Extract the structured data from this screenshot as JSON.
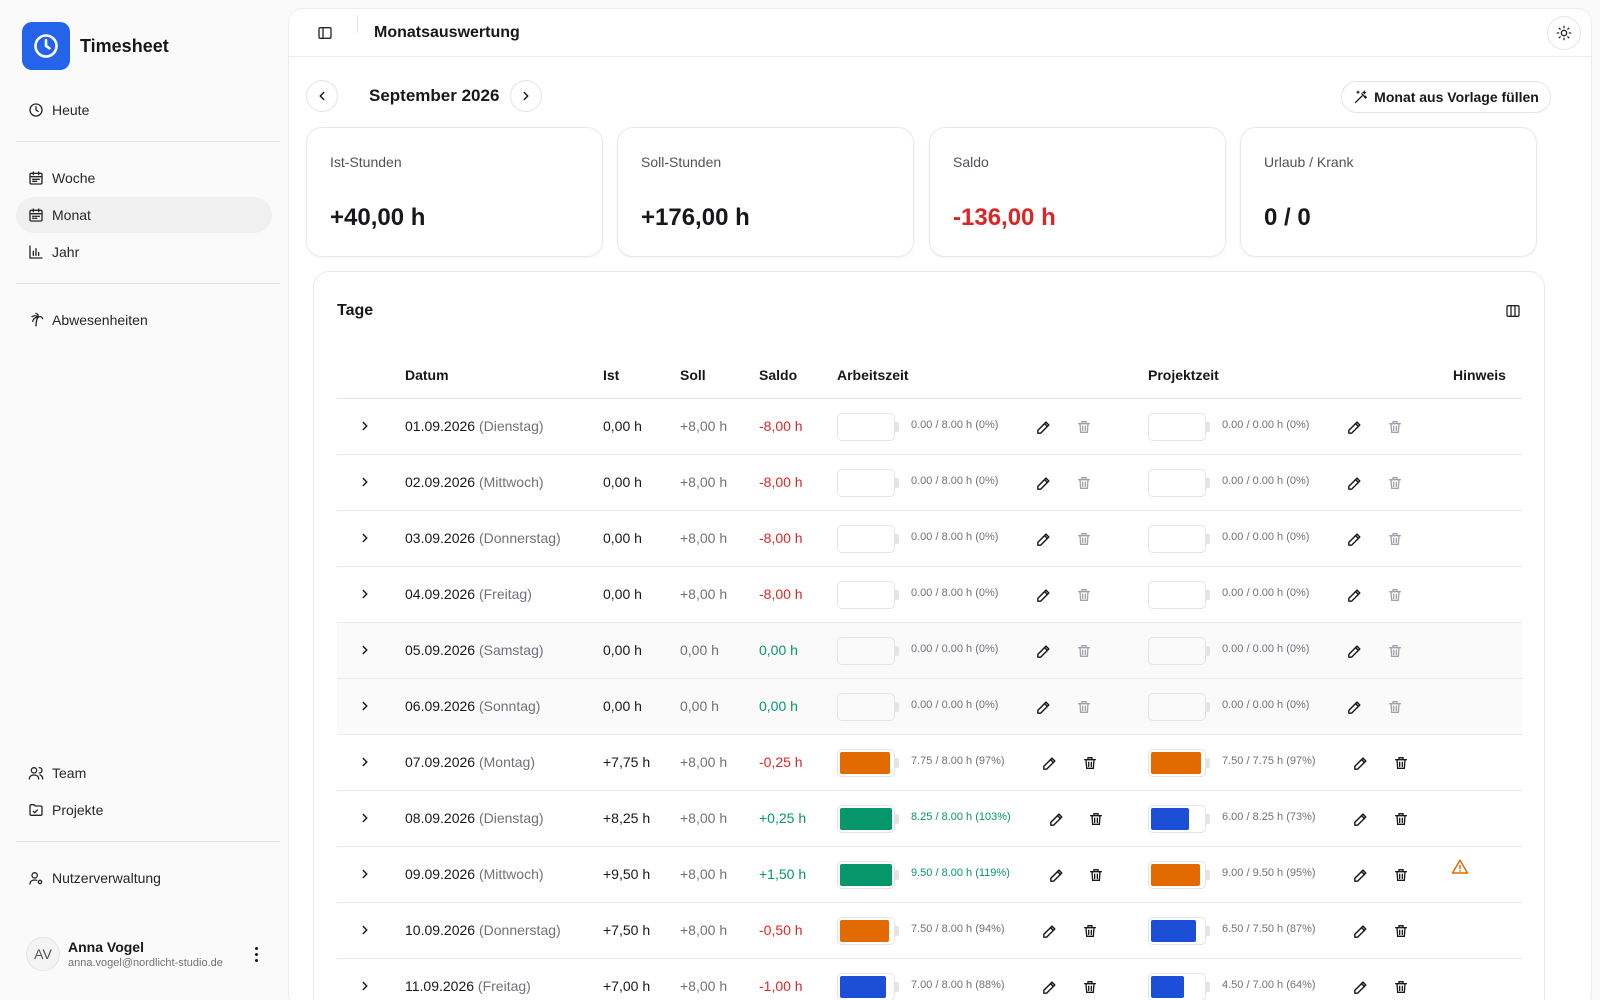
{
  "app": {
    "name": "Timesheet"
  },
  "nav": {
    "heute": "Heute",
    "woche": "Woche",
    "monat": "Monat",
    "jahr": "Jahr",
    "abwesenheiten": "Abwesenheiten",
    "team": "Team",
    "projekte": "Projekte",
    "nutzerverwaltung": "Nutzerverwaltung"
  },
  "user": {
    "initials": "AV",
    "name": "Anna Vogel",
    "email": "anna.vogel@nordlicht-studio.de"
  },
  "header": {
    "title": "Monatsauswertung"
  },
  "month": {
    "label": "September 2026",
    "fill_button": "Monat aus Vorlage füllen"
  },
  "cards": [
    {
      "label": "Ist-Stunden",
      "value": "+40,00 h"
    },
    {
      "label": "Soll-Stunden",
      "value": "+176,00 h"
    },
    {
      "label": "Saldo",
      "value": "-136,00 h"
    },
    {
      "label": "Urlaub / Krank",
      "value": "0 / 0"
    }
  ],
  "colors": {
    "accent": "#2563eb",
    "orange": "#e26a00",
    "green": "#059669",
    "blue": "#1d4ed8",
    "negative": "#dc2626"
  },
  "table": {
    "title": "Tage",
    "columns": {
      "datum": "Datum",
      "ist": "Ist",
      "soll": "Soll",
      "saldo": "Saldo",
      "arbeitszeit": "Arbeitszeit",
      "projektzeit": "Projektzeit",
      "hinweis": "Hinweis"
    },
    "rows": [
      {
        "date": "01.09.2026",
        "day": "(Dienstag)",
        "ist": "0,00 h",
        "soll": "+8,00 h",
        "saldo": "-8,00 h",
        "saldo_sign": "neg",
        "weekend": false,
        "work": {
          "text": "0.00 / 8.00 h (0%)",
          "level": 0,
          "color": "none",
          "over": false
        },
        "proj": {
          "text": "0.00 / 0.00 h (0%)",
          "level": 0,
          "color": "none"
        },
        "warning": false
      },
      {
        "date": "02.09.2026",
        "day": "(Mittwoch)",
        "ist": "0,00 h",
        "soll": "+8,00 h",
        "saldo": "-8,00 h",
        "saldo_sign": "neg",
        "weekend": false,
        "work": {
          "text": "0.00 / 8.00 h (0%)",
          "level": 0,
          "color": "none",
          "over": false
        },
        "proj": {
          "text": "0.00 / 0.00 h (0%)",
          "level": 0,
          "color": "none"
        },
        "warning": false
      },
      {
        "date": "03.09.2026",
        "day": "(Donnerstag)",
        "ist": "0,00 h",
        "soll": "+8,00 h",
        "saldo": "-8,00 h",
        "saldo_sign": "neg",
        "weekend": false,
        "work": {
          "text": "0.00 / 8.00 h (0%)",
          "level": 0,
          "color": "none",
          "over": false
        },
        "proj": {
          "text": "0.00 / 0.00 h (0%)",
          "level": 0,
          "color": "none"
        },
        "warning": false
      },
      {
        "date": "04.09.2026",
        "day": "(Freitag)",
        "ist": "0,00 h",
        "soll": "+8,00 h",
        "saldo": "-8,00 h",
        "saldo_sign": "neg",
        "weekend": false,
        "work": {
          "text": "0.00 / 8.00 h (0%)",
          "level": 0,
          "color": "none",
          "over": false
        },
        "proj": {
          "text": "0.00 / 0.00 h (0%)",
          "level": 0,
          "color": "none"
        },
        "warning": false
      },
      {
        "date": "05.09.2026",
        "day": "(Samstag)",
        "ist": "0,00 h",
        "soll": "0,00 h",
        "saldo": "0,00 h",
        "saldo_sign": "pos",
        "weekend": true,
        "work": {
          "text": "0.00 / 0.00 h (0%)",
          "level": 0,
          "color": "none",
          "over": false
        },
        "proj": {
          "text": "0.00 / 0.00 h (0%)",
          "level": 0,
          "color": "none"
        },
        "warning": false
      },
      {
        "date": "06.09.2026",
        "day": "(Sonntag)",
        "ist": "0,00 h",
        "soll": "0,00 h",
        "saldo": "0,00 h",
        "saldo_sign": "pos",
        "weekend": true,
        "work": {
          "text": "0.00 / 0.00 h (0%)",
          "level": 0,
          "color": "none",
          "over": false
        },
        "proj": {
          "text": "0.00 / 0.00 h (0%)",
          "level": 0,
          "color": "none"
        },
        "warning": false
      },
      {
        "date": "07.09.2026",
        "day": "(Montag)",
        "ist": "+7,75 h",
        "soll": "+8,00 h",
        "saldo": "-0,25 h",
        "saldo_sign": "neg",
        "weekend": false,
        "work": {
          "text": "7.75 / 8.00 h (97%)",
          "level": 0.97,
          "color": "orange",
          "over": false
        },
        "proj": {
          "text": "7.50 / 7.75 h (97%)",
          "level": 0.97,
          "color": "orange"
        },
        "warning": false
      },
      {
        "date": "08.09.2026",
        "day": "(Dienstag)",
        "ist": "+8,25 h",
        "soll": "+8,00 h",
        "saldo": "+0,25 h",
        "saldo_sign": "pos",
        "weekend": false,
        "work": {
          "text": "8.25 / 8.00 h (103%)",
          "level": 1,
          "color": "green",
          "over": true
        },
        "proj": {
          "text": "6.00 / 8.25 h (73%)",
          "level": 0.73,
          "color": "blue"
        },
        "warning": false
      },
      {
        "date": "09.09.2026",
        "day": "(Mittwoch)",
        "ist": "+9,50 h",
        "soll": "+8,00 h",
        "saldo": "+1,50 h",
        "saldo_sign": "pos",
        "weekend": false,
        "work": {
          "text": "9.50 / 8.00 h (119%)",
          "level": 1,
          "color": "green",
          "over": true
        },
        "proj": {
          "text": "9.00 / 9.50 h (95%)",
          "level": 0.95,
          "color": "orange"
        },
        "warning": true
      },
      {
        "date": "10.09.2026",
        "day": "(Donnerstag)",
        "ist": "+7,50 h",
        "soll": "+8,00 h",
        "saldo": "-0,50 h",
        "saldo_sign": "neg",
        "weekend": false,
        "work": {
          "text": "7.50 / 8.00 h (94%)",
          "level": 0.94,
          "color": "orange",
          "over": false
        },
        "proj": {
          "text": "6.50 / 7.50 h (87%)",
          "level": 0.87,
          "color": "blue"
        },
        "warning": false
      },
      {
        "date": "11.09.2026",
        "day": "(Freitag)",
        "ist": "+7,00 h",
        "soll": "+8,00 h",
        "saldo": "-1,00 h",
        "saldo_sign": "neg",
        "weekend": false,
        "work": {
          "text": "7.00 / 8.00 h (88%)",
          "level": 0.88,
          "color": "blue",
          "over": false
        },
        "proj": {
          "text": "4.50 / 7.00 h (64%)",
          "level": 0.64,
          "color": "blue"
        },
        "warning": false
      }
    ]
  }
}
